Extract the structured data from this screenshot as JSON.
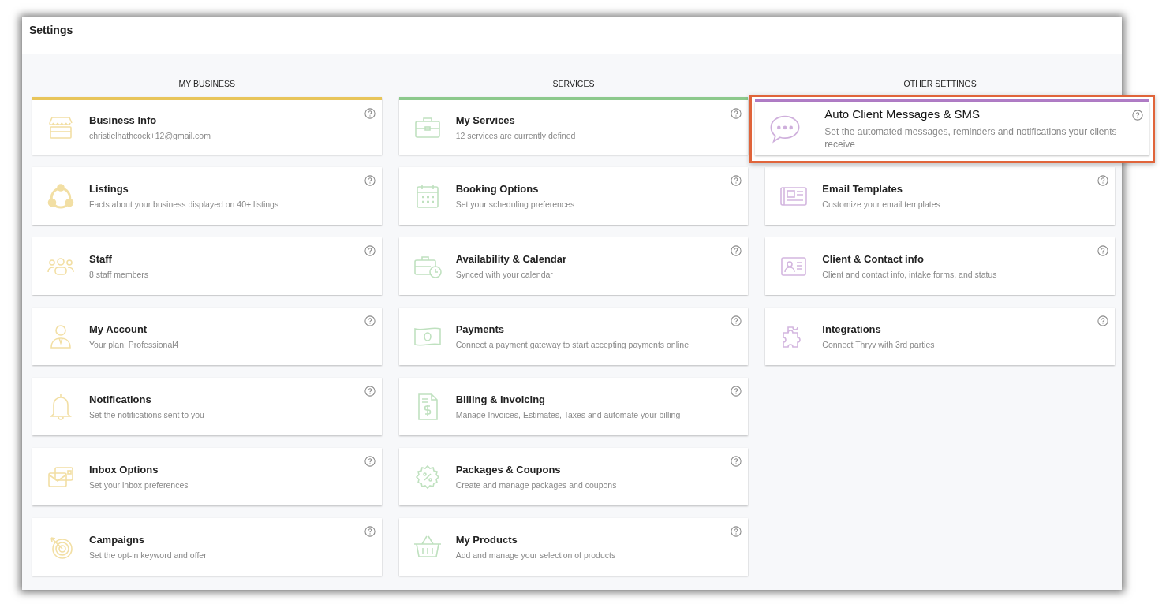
{
  "window": {
    "title": "Settings"
  },
  "columns": [
    {
      "heading": "MY BUSINESS",
      "color": "#e8c55a",
      "cards": [
        {
          "title": "Business Info",
          "subtitle": "christielhathcock+12@gmail.com",
          "highlighted": false
        },
        {
          "title": "Listings",
          "subtitle": "Facts about your business displayed on 40+ listings",
          "highlighted": false
        },
        {
          "title": "Staff",
          "subtitle": "8 staff members",
          "highlighted": false
        },
        {
          "title": "My Account",
          "subtitle": "Your plan: Professional4",
          "highlighted": false
        },
        {
          "title": "Notifications",
          "subtitle": "Set the notifications sent to you",
          "highlighted": false
        },
        {
          "title": "Inbox Options",
          "subtitle": "Set your inbox preferences",
          "highlighted": false
        },
        {
          "title": "Campaigns",
          "subtitle": "Set the opt-in keyword and offer",
          "highlighted": false
        }
      ]
    },
    {
      "heading": "SERVICES",
      "color": "#8cc98c",
      "cards": [
        {
          "title": "My Services",
          "subtitle": "12 services are currently defined",
          "highlighted": false
        },
        {
          "title": "Booking Options",
          "subtitle": "Set your scheduling preferences",
          "highlighted": false
        },
        {
          "title": "Availability & Calendar",
          "subtitle": "Synced with your calendar",
          "highlighted": false
        },
        {
          "title": "Payments",
          "subtitle": "Connect a payment gateway to start accepting payments online",
          "highlighted": false
        },
        {
          "title": "Billing & Invoicing",
          "subtitle": "Manage Invoices, Estimates, Taxes and automate your billing",
          "highlighted": false
        },
        {
          "title": "Packages & Coupons",
          "subtitle": "Create and manage packages and coupons",
          "highlighted": false
        },
        {
          "title": "My Products",
          "subtitle": "Add and manage your selection of products",
          "highlighted": false
        }
      ]
    },
    {
      "heading": "OTHER SETTINGS",
      "color": "#b07cc6",
      "cards": [
        {
          "title": "Auto Client Messages & SMS",
          "subtitle": "Set the automated messages, reminders and notifications your clients receive",
          "highlighted": true
        },
        {
          "title": "Email Templates",
          "subtitle": "Customize your email templates",
          "highlighted": false
        },
        {
          "title": "Client & Contact info",
          "subtitle": "Client and contact info, intake forms, and status",
          "highlighted": false
        },
        {
          "title": "Integrations",
          "subtitle": "Connect Thryv with 3rd parties",
          "highlighted": false
        }
      ]
    }
  ]
}
